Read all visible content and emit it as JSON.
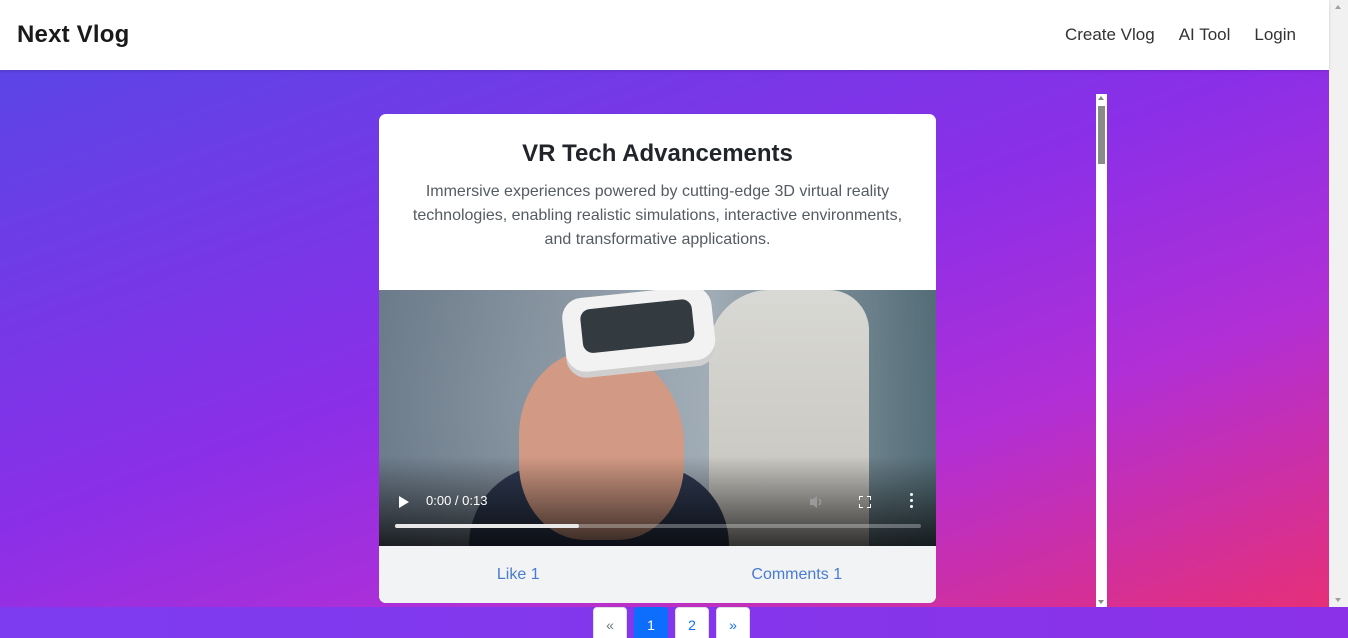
{
  "navbar": {
    "brand": "Next Vlog",
    "links": [
      "Create Vlog",
      "AI Tool",
      "Login"
    ]
  },
  "card": {
    "title": "VR Tech Advancements",
    "description": "Immersive experiences powered by cutting-edge 3D virtual reality technologies, enabling realistic simulations, interactive environments, and transformative applications.",
    "video": {
      "time": "0:00 / 0:13",
      "progress_fraction": 0.35
    },
    "like_label": "Like 1",
    "comments_label": "Comments 1"
  },
  "pagination": {
    "prev": "«",
    "pages": [
      "1",
      "2"
    ],
    "next": "»",
    "active_page": "1"
  },
  "colors": {
    "gradient_start": "#5b45e6",
    "gradient_end": "#e62f78",
    "link": "#4a7bd0",
    "active_page": "#0d6efd"
  }
}
